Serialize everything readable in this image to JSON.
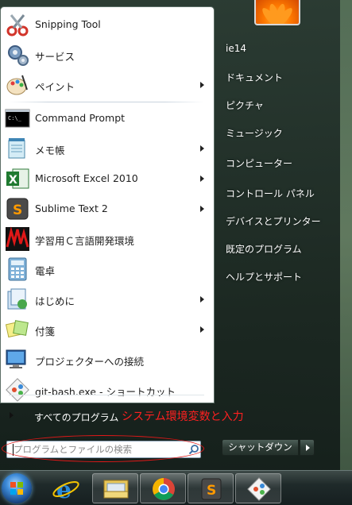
{
  "programs": [
    {
      "label": "Snipping Tool",
      "icon": "scissors-icon",
      "has_submenu": false
    },
    {
      "label": "サービス",
      "icon": "gears-icon",
      "has_submenu": false
    },
    {
      "label": "ペイント",
      "icon": "paint-palette-icon",
      "has_submenu": true
    },
    {
      "label": "Command Prompt",
      "icon": "command-prompt-icon",
      "has_submenu": false
    },
    {
      "label": "メモ帳",
      "icon": "notepad-icon",
      "has_submenu": true
    },
    {
      "label": "Microsoft Excel 2010",
      "icon": "excel-icon",
      "has_submenu": true
    },
    {
      "label": "Sublime Text 2",
      "icon": "sublime-text-icon",
      "has_submenu": true
    },
    {
      "label": "学習用Ｃ言語開発環境",
      "icon": "c-dev-env-icon",
      "has_submenu": false
    },
    {
      "label": "電卓",
      "icon": "calculator-icon",
      "has_submenu": false
    },
    {
      "label": "はじめに",
      "icon": "getting-started-icon",
      "has_submenu": true
    },
    {
      "label": "付箋",
      "icon": "sticky-notes-icon",
      "has_submenu": true
    },
    {
      "label": "プロジェクターへの接続",
      "icon": "projector-icon",
      "has_submenu": false
    },
    {
      "label": "git-bash.exe - ショートカット",
      "icon": "git-icon",
      "has_submenu": false
    }
  ],
  "all_programs": "すべてのプログラム",
  "annotation": "システム環境変数と入力",
  "search": {
    "placeholder": "プログラムとファイルの検索"
  },
  "right_links": [
    "ie14",
    "ドキュメント",
    "ピクチャ",
    "ミュージック",
    "コンピューター",
    "コントロール パネル",
    "デバイスとプリンター",
    "既定のプログラム",
    "ヘルプとサポート"
  ],
  "shutdown": "シャットダウン",
  "taskbar": [
    "start-orb-icon",
    "internet-explorer-icon",
    "explorer-folder-icon",
    "chrome-icon",
    "sublime-text-icon",
    "git-icon"
  ],
  "colors": {
    "annotation": "#ff2020",
    "menu_bg": "#ffffff",
    "glass": "#2c3c35"
  }
}
